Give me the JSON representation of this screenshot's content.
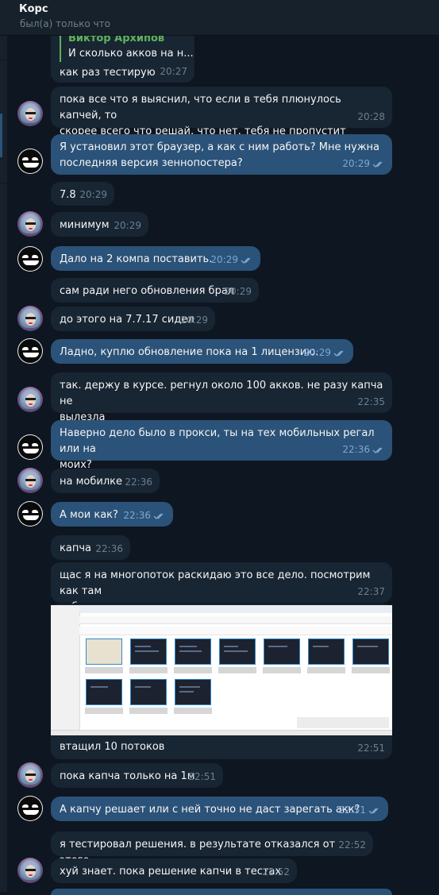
{
  "header": {
    "title": "Корс",
    "status": "был(а) только что"
  },
  "reply_quote": {
    "author": "Виктор Архипов",
    "text": "И сколько акков на н..."
  },
  "messages": [
    {
      "text": "как раз тестирую",
      "time": "20:27"
    },
    {
      "text": "пока все что я выяснил, что если в тебя плюнулось капчей, то\nскорее всего что решай, что нет, тебя не пропустит",
      "time": "20:28"
    },
    {
      "text": "Я установил этот браузер, а как с ним работь? Мне нужна\nпоследняя версия зеннопостера?",
      "time": "20:29"
    },
    {
      "text": "7.8",
      "time": "20:29"
    },
    {
      "text": "минимум",
      "time": "20:29"
    },
    {
      "text": "Дало на 2 компа поставить.",
      "time": "20:29"
    },
    {
      "text": "сам ради него обновления брал",
      "time": "20:29"
    },
    {
      "text": "до этого на 7.7.17 сидел",
      "time": "20:29"
    },
    {
      "text": "Ладно, куплю обновление пока на 1 лицензию.",
      "time": "20:29"
    },
    {
      "text": "так. держу в курсе. регнул около 100 акков. не разу капча не\nвылезла",
      "time": "22:35"
    },
    {
      "text": "Наверно дело было в прокси, ты на тех мобильных регал или на\nмоих?",
      "time": "22:36"
    },
    {
      "text": "на мобилке",
      "time": "22:36"
    },
    {
      "text": "А мои как?",
      "time": "22:36"
    },
    {
      "text": "капча",
      "time": "22:36"
    },
    {
      "text": "щас я на многопоток раскидаю это все дело. посмотрим как там\nсебя покажет",
      "time": "22:37"
    },
    {
      "text": "втащил 10 потоков",
      "time": "22:51"
    },
    {
      "text": "пока капча только на 1м",
      "time": "22:51"
    },
    {
      "text": "А капчу решает или с ней точно не даст зарегать акк?",
      "time": "22:51"
    },
    {
      "text": "я тестировал решения. в результате отказался от этого",
      "time": "22:52"
    },
    {
      "text": "хуй знает. пока решение капчи в тестах",
      "time": "22:52"
    }
  ],
  "colors": {
    "background": "#0e1621",
    "incoming_bubble": "#182533",
    "outgoing_bubble": "#2b5278",
    "reply_accent": "#5fb35a",
    "read_check": "#7da8d3"
  }
}
